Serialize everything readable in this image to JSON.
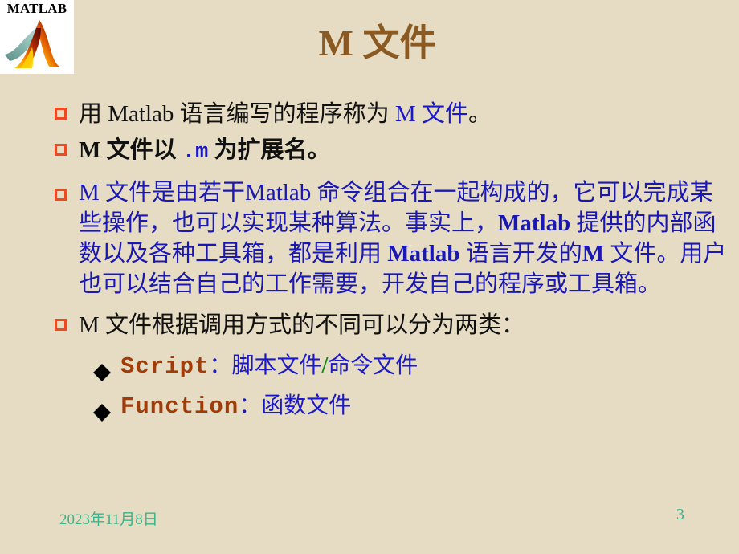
{
  "slide": {
    "title": "M 文件",
    "background_color": "#e6dcc3",
    "title_color": "#8a5a22"
  },
  "logo": {
    "wordmark": "MATLAB",
    "icon_name": "matlab-membrane-logo"
  },
  "bullets": [
    {
      "marker": "square",
      "marker_color": "#ea4b23",
      "segments": [
        {
          "text": "用 Matlab 语言编写的程序称为 ",
          "style": "black-serif"
        },
        {
          "text": "M 文件",
          "style": "blue-serif"
        },
        {
          "text": "。",
          "style": "black-serif"
        }
      ]
    },
    {
      "marker": "square",
      "marker_color": "#ea4b23",
      "segments": [
        {
          "text": "M 文件以 ",
          "style": "black-serif-bold"
        },
        {
          "text": ".m",
          "style": "blue-mono-bold"
        },
        {
          "text": " 为扩展名。",
          "style": "black-serif-bold"
        }
      ]
    }
  ],
  "paragraph": {
    "marker": "square",
    "marker_color": "#ea4b23",
    "color": "#1a18b4",
    "lines": [
      [
        {
          "text": " M 文件是由若干",
          "style": "blue-serif"
        },
        {
          "text": "Matlab",
          "style": "blue-serif"
        },
        {
          "text": " 命令组合在一起构成的，它可以",
          "style": "blue-serif"
        }
      ],
      [
        {
          "text": "完成某些操作，也可以实现某种算法。事实上，",
          "style": "blue-serif"
        },
        {
          "text": "Matlab",
          "style": "blue-serif-bold"
        },
        {
          "text": " 提供",
          "style": "blue-serif"
        }
      ],
      [
        {
          "text": "的内部函数以及各种工具箱，都是利用 ",
          "style": "blue-serif"
        },
        {
          "text": "Matlab",
          "style": "blue-serif-bold"
        },
        {
          "text": " 语言开发的",
          "style": "blue-serif"
        }
      ],
      [
        {
          "text": "M",
          "style": "blue-serif-bold"
        },
        {
          "text": " 文件。用户也可以结合自己的工作需要，开发自己的程序",
          "style": "blue-serif"
        }
      ],
      [
        {
          "text": "或工具箱。",
          "style": "blue-serif"
        }
      ]
    ]
  },
  "bullet_last": {
    "marker": "square",
    "marker_color": "#ea4b23",
    "text": "M 文件根据调用方式的不同可以分为两类："
  },
  "sub_bullets": [
    {
      "marker": "diamond",
      "marker_color": "#000000",
      "keyword": "Script",
      "keyword_color": "#a13c09",
      "colon": "：",
      "desc_before": "脚本文件",
      "separator": "/",
      "separator_color": "#108c18",
      "desc_after": "命令文件"
    },
    {
      "marker": "diamond",
      "marker_color": "#000000",
      "keyword": "Function",
      "keyword_color": "#a13c09",
      "colon": "：",
      "desc_before": "函数文件",
      "separator": "",
      "separator_color": "#108c18",
      "desc_after": ""
    }
  ],
  "footer": {
    "date": "2023年11月8日",
    "page_number": "3",
    "color": "#3cb48c"
  }
}
